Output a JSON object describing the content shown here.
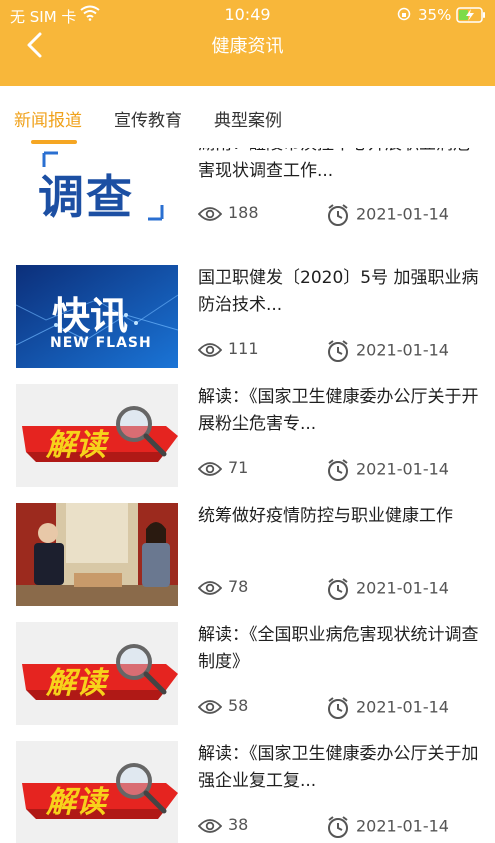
{
  "status_bar": {
    "carrier": "无 SIM 卡",
    "time": "10:49",
    "battery": "35%"
  },
  "header": {
    "title": "健康资讯",
    "background_color": "#f8b73a"
  },
  "tabs": [
    {
      "label": "新闻报道",
      "active": true
    },
    {
      "label": "宣传教育",
      "active": false
    },
    {
      "label": "典型案例",
      "active": false
    }
  ],
  "accent_color": "#f5a623",
  "articles": [
    {
      "title": "湖南：醴陵市疾控中心开展职业病危害现状调查工作...",
      "views": "188",
      "date": "2021-01-14",
      "thumb_text": "调查",
      "thumb_kind": "investigation"
    },
    {
      "title": "国卫职健发〔2020〕5号 加强职业病防治技术...",
      "views": "111",
      "date": "2021-01-14",
      "thumb_text": "快讯",
      "thumb_sub": "NEW FLASH",
      "thumb_kind": "flash"
    },
    {
      "title": "解读：《国家卫生健康委办公厅关于开展粉尘危害专...",
      "views": "71",
      "date": "2021-01-14",
      "thumb_text": "解读",
      "thumb_kind": "interpret"
    },
    {
      "title": "统筹做好疫情防控与职业健康工作",
      "views": "78",
      "date": "2021-01-14",
      "thumb_kind": "meeting-photo"
    },
    {
      "title": "解读：《全国职业病危害现状统计调查制度》",
      "views": "58",
      "date": "2021-01-14",
      "thumb_text": "解读",
      "thumb_kind": "interpret"
    },
    {
      "title": "解读：《国家卫生健康委办公厅关于加强企业复工复...",
      "views": "38",
      "date": "2021-01-14",
      "thumb_text": "解读",
      "thumb_kind": "interpret"
    }
  ],
  "icons": {
    "back": "chevron-left-icon",
    "views": "eye-icon",
    "date": "clock-icon",
    "wifi": "wifi-icon",
    "battery": "battery-charging-icon",
    "lock": "rotation-lock-icon"
  }
}
